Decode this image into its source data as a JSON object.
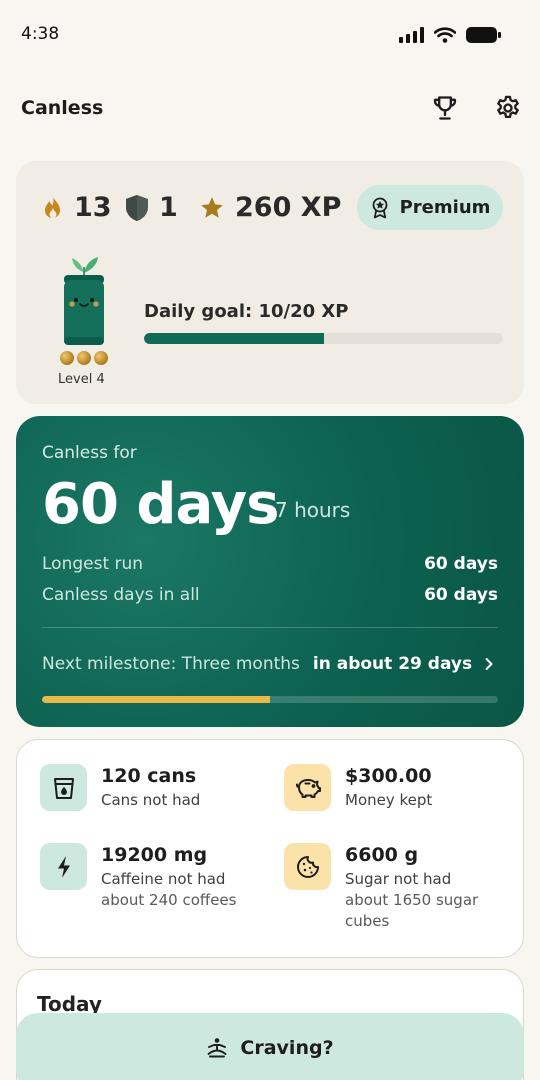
{
  "status_bar": {
    "time": "4:38"
  },
  "header": {
    "title": "Canless",
    "trophy_icon": "trophy-icon",
    "settings_icon": "gear-icon"
  },
  "stats": {
    "streak_flames": "13",
    "shields": "1",
    "xp": "260 XP",
    "premium_label": "Premium",
    "level_label": "Level 4",
    "daily_goal_label": "Daily goal: 10/20 XP",
    "daily_goal_fraction": 0.5,
    "level_dots": 3
  },
  "streak": {
    "eyebrow": "Canless for",
    "days": "60 days",
    "hours": "7 hours",
    "longest_run_label": "Longest run",
    "longest_run_value": "60 days",
    "total_days_label": "Canless days in all",
    "total_days_value": "60 days",
    "milestone_label": "Next milestone: Three months",
    "milestone_eta": "in about 29 days",
    "milestone_fraction": 0.5
  },
  "savings": [
    {
      "icon": "cup-icon",
      "value": "120 cans",
      "label": "Cans not had",
      "sub": "",
      "color": "#cde8df"
    },
    {
      "icon": "piggy-bank-icon",
      "value": "$300.00",
      "label": "Money kept",
      "sub": "",
      "color": "#fbe2a8"
    },
    {
      "icon": "lightning-icon",
      "value": "19200 mg",
      "label": "Caffeine not had",
      "sub": "about 240 coffees",
      "color": "#cde8df"
    },
    {
      "icon": "cookie-icon",
      "value": "6600 g",
      "label": "Sugar not had",
      "sub": "about 1650 sugar cubes",
      "color": "#fbe2a8"
    }
  ],
  "today": {
    "title": "Today"
  },
  "craving": {
    "label": "Craving?"
  },
  "colors": {
    "accent": "#0d6150",
    "gold": "#e9b949",
    "mint": "#cde8de",
    "background": "#f8f6f1"
  }
}
